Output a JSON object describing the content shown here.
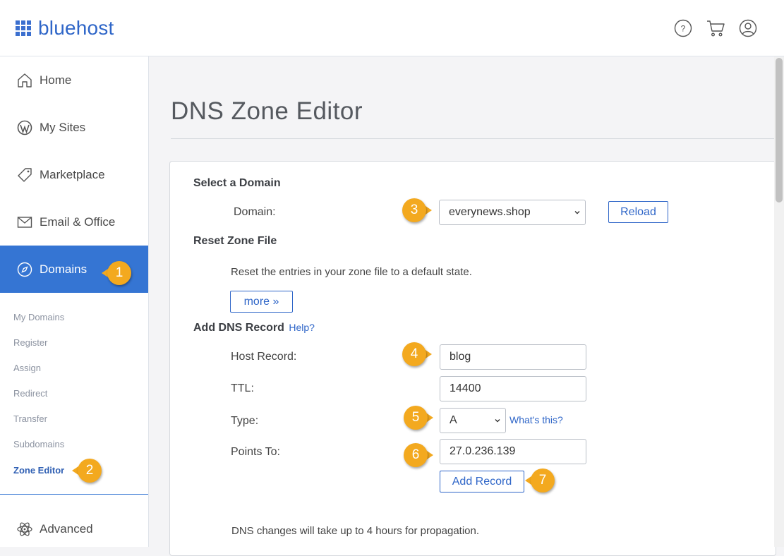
{
  "header": {
    "brand": "bluehost",
    "icons": [
      "help-icon",
      "cart-icon",
      "user-icon"
    ]
  },
  "sidebar": {
    "items": [
      {
        "label": "Home",
        "icon": "home-icon"
      },
      {
        "label": "My Sites",
        "icon": "wordpress-icon"
      },
      {
        "label": "Marketplace",
        "icon": "tag-icon"
      },
      {
        "label": "Email & Office",
        "icon": "mail-icon"
      },
      {
        "label": "Domains",
        "icon": "compass-icon",
        "active": true
      },
      {
        "label": "Advanced",
        "icon": "atom-icon"
      }
    ],
    "sub_items": [
      "My Domains",
      "Register",
      "Assign",
      "Redirect",
      "Transfer",
      "Subdomains",
      "Zone Editor"
    ],
    "active_sub": "Zone Editor"
  },
  "page": {
    "title": "DNS Zone Editor"
  },
  "select_domain": {
    "heading": "Select a Domain",
    "domain_label": "Domain:",
    "domain_value": "everynews.shop",
    "reload_label": "Reload"
  },
  "reset_zone": {
    "heading": "Reset Zone File",
    "description": "Reset the entries in your zone file to a default state.",
    "more_label": "more »"
  },
  "add_record": {
    "heading": "Add DNS Record",
    "help_label": "Help?",
    "host_label": "Host Record:",
    "host_value": "blog",
    "ttl_label": "TTL:",
    "ttl_value": "14400",
    "type_label": "Type:",
    "type_value": "A",
    "whats_this": "What's this?",
    "points_label": "Points To:",
    "points_value": "27.0.236.139",
    "add_button": "Add Record",
    "note": "DNS changes will take up to 4 hours for propagation."
  },
  "badges": [
    "1",
    "2",
    "3",
    "4",
    "5",
    "6",
    "7"
  ],
  "colors": {
    "brand": "#2f66c8",
    "active_nav": "#3575d3",
    "badge": "#f3a91f"
  }
}
